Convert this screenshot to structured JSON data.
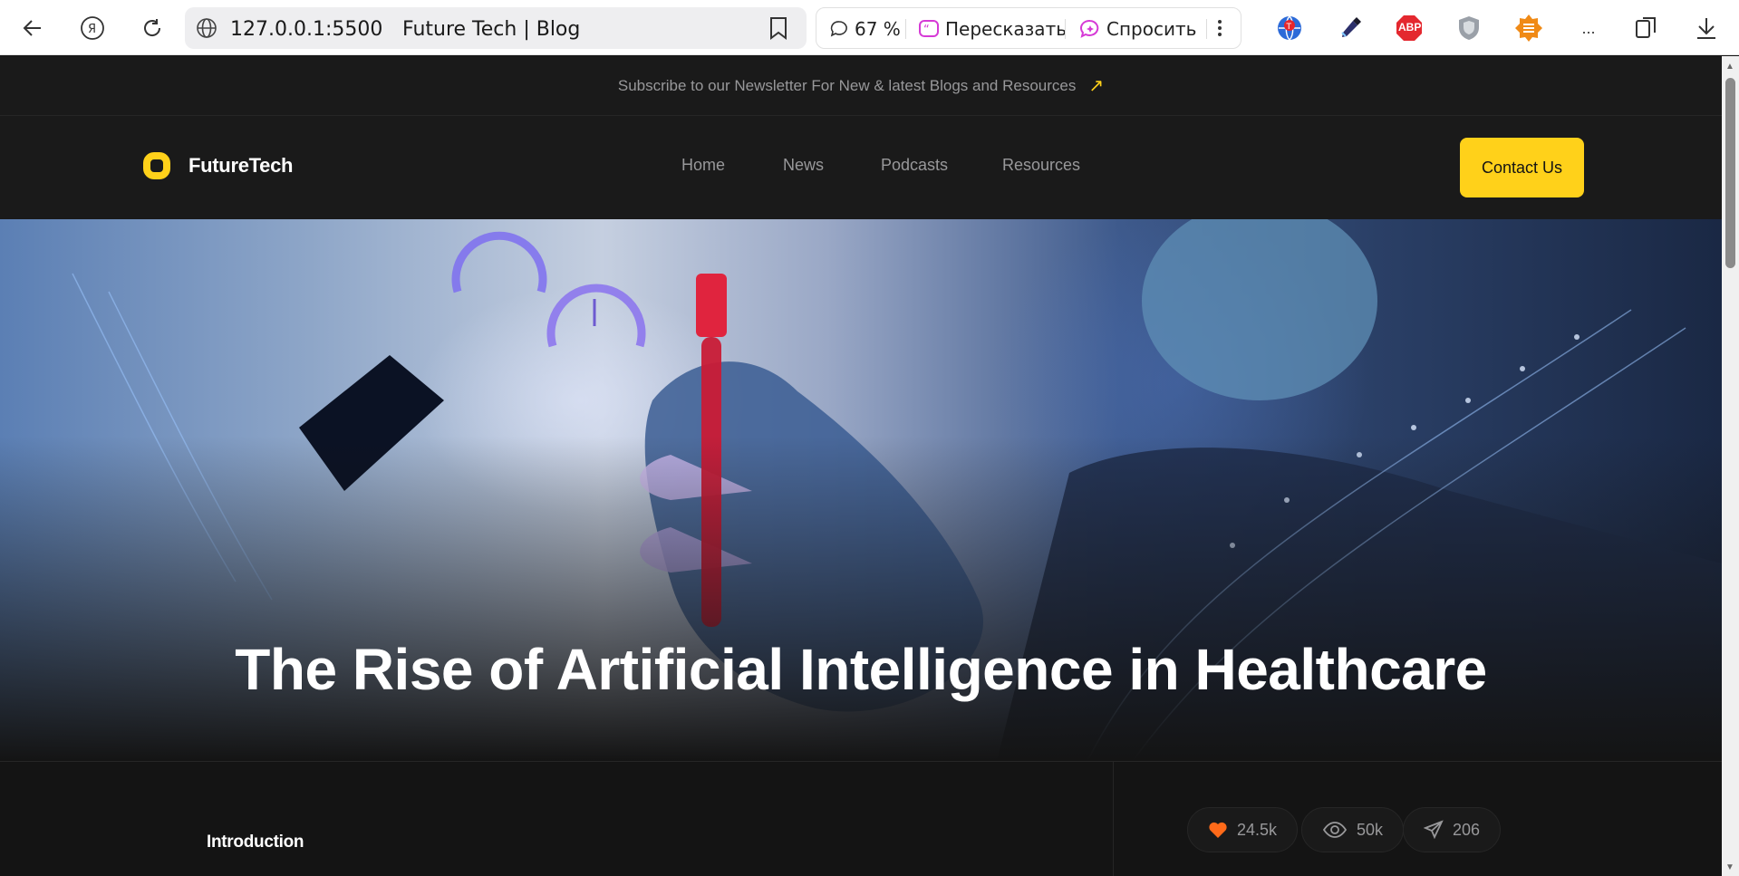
{
  "browser": {
    "url": "127.0.0.1:5500",
    "tab_title": "Future Tech | Blog",
    "zoom": "67 %",
    "retell_label": "Пересказать",
    "ask_label": "Спросить",
    "abp_label": "ABP",
    "more_label": "..."
  },
  "newsletter": {
    "text": "Subscribe to our Newsletter For New & latest Blogs and Resources",
    "arrow": "↗"
  },
  "nav": {
    "logo_text": "FutureTech",
    "links": [
      "Home",
      "News",
      "Podcasts",
      "Resources"
    ],
    "contact_label": "Contact Us"
  },
  "hero": {
    "title": "The Rise of Artificial Intelligence in Healthcare"
  },
  "article": {
    "section_title": "Introduction",
    "likes": "24.5k",
    "views": "50k",
    "shares": "206"
  },
  "colors": {
    "accent": "#ffd11a",
    "background": "#141414",
    "like": "#ff6a19"
  }
}
